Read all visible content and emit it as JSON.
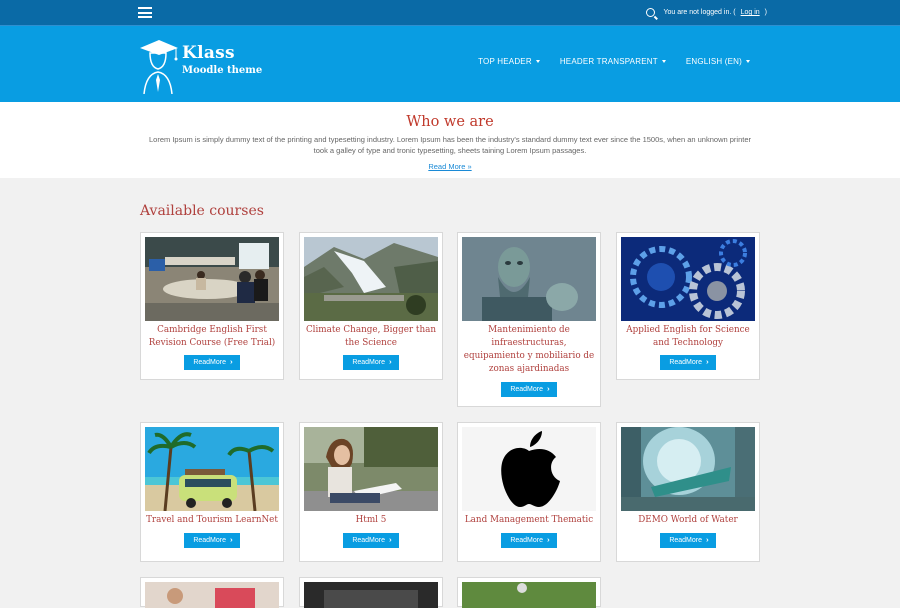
{
  "topbar": {
    "login_text": "You are not logged in. (",
    "login_link": "Log in",
    "login_close": ")"
  },
  "brand": {
    "title": "Klass",
    "subtitle": "Moodle theme"
  },
  "nav": [
    {
      "label": "TOP HEADER"
    },
    {
      "label": "HEADER TRANSPARENT"
    },
    {
      "label": "ENGLISH (EN)"
    }
  ],
  "about": {
    "title": "Who we are",
    "text": "Lorem Ipsum is simply dummy text of the printing and typesetting industry. Lorem Ipsum has been the industry's standard dummy text ever since the 1500s, when an unknown printer took a galley of type and tronic typesetting, sheets taining Lorem Ipsum passages.",
    "link": "Read More »"
  },
  "courses": {
    "title": "Available courses",
    "button_label": "ReadMore",
    "items": [
      {
        "title": "Cambridge English First Revision Course (Free Trial)"
      },
      {
        "title": "Climate Change, Bigger than the Science"
      },
      {
        "title": "Mantenimiento de infraestructuras, equipamiento y mobiliario de zonas ajardinadas"
      },
      {
        "title": "Applied English for Science and Technology"
      },
      {
        "title": "Travel and Tourism LearnNet"
      },
      {
        "title": "Html 5"
      },
      {
        "title": "Land Management Thematic"
      },
      {
        "title": "DEMO World of Water"
      }
    ]
  },
  "colors": {
    "topbar": "#0a6aa6",
    "header": "#099de2",
    "accent_red": "#b0413e",
    "button": "#099de2"
  }
}
